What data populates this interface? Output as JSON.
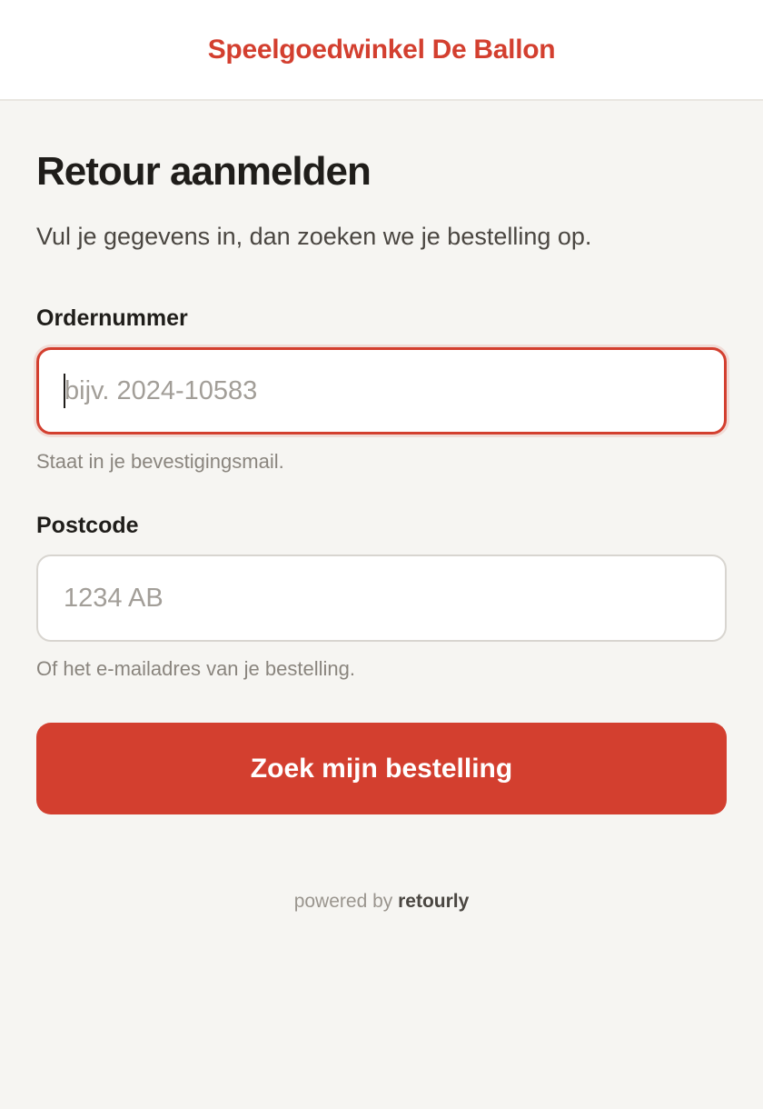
{
  "header": {
    "brand": "Speelgoedwinkel De Ballon"
  },
  "main": {
    "title": "Retour aanmelden",
    "subtitle": "Vul je gegevens in, dan zoeken we je bestelling op."
  },
  "form": {
    "order_number": {
      "label": "Ordernummer",
      "value": "",
      "placeholder": "bijv. 2024-10583",
      "help": "Staat in je bevestigingsmail.",
      "focused": true
    },
    "postcode": {
      "label": "Postcode",
      "value": "",
      "placeholder": "1234 AB",
      "help": "Of het e-mailadres van je bestelling."
    },
    "submit_label": "Zoek mijn bestelling"
  },
  "footer": {
    "powered_by": "powered by",
    "brand": "retourly"
  },
  "colors": {
    "accent": "#d33f2f",
    "background": "#f6f5f2",
    "header_background": "#ffffff",
    "text": "#1f1d1a",
    "muted_text": "#8a857e"
  }
}
